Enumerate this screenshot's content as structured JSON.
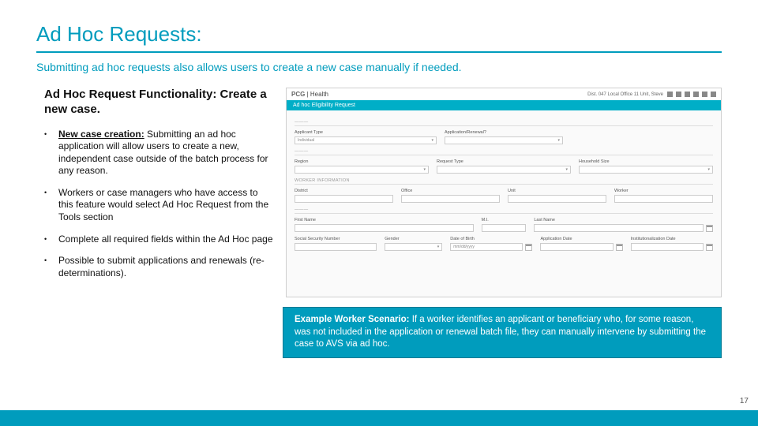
{
  "title": "Ad Hoc Requests:",
  "subtitle": "Submitting ad hoc requests also allows users to create a new case manually if needed.",
  "left_heading": "Ad Hoc Request Functionality: Create a new case.",
  "bullets": [
    {
      "lead": "New case creation:",
      "text": " Submitting an ad hoc application will allow users to create a new, independent case outside of the batch process for any reason."
    },
    {
      "lead": "",
      "text": "Workers or case managers who have access to this feature would select Ad Hoc Request from the Tools section"
    },
    {
      "lead": "",
      "text": "Complete all required fields within the Ad Hoc page"
    },
    {
      "lead": "",
      "text": "Possible to submit applications and renewals (re-determinations)."
    }
  ],
  "scenario": {
    "label": "Example Worker Scenario:",
    "text": " If a worker identifies an applicant or beneficiary who, for some reason, was not included in the application or renewal batch file, they can manually intervene by submitting the case to AVS via ad hoc."
  },
  "page_number": "17",
  "shot": {
    "brand_left": "PCG",
    "brand_right": "Health",
    "top_user": "Dist. 047 Local Office 11 Unit, Steve",
    "bar_title": "Ad hoc Eligibility Request",
    "sections": {
      "s1": "———",
      "s2": "———",
      "s3": "WORKER INFORMATION",
      "s4": "———"
    },
    "fields": {
      "applicant_type": "Applicant Type",
      "application_renewal": "Application/Renewal?",
      "individual": "Individual",
      "region": "Region",
      "request_type": "Request Type",
      "household_size": "Household Size",
      "district": "District",
      "office": "Office",
      "unit": "Unit",
      "worker": "Worker",
      "first_name": "First Name",
      "mi": "M.I.",
      "last_name": "Last Name",
      "ssn": "Social Security Number",
      "gender": "Gender",
      "dob": "Date of Birth",
      "app_date": "Application Date",
      "inst_date": "Institutionalization Date",
      "dob_val": "mm/dd/yyyy"
    }
  }
}
